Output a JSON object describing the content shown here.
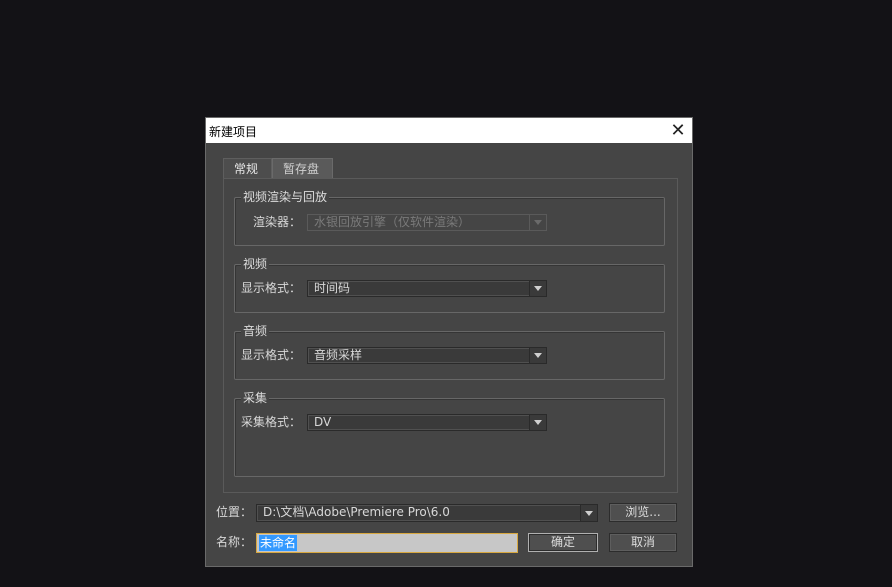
{
  "dialog": {
    "title": "新建项目",
    "close_glyph": "✕"
  },
  "tabs": [
    {
      "label": "常规",
      "active": true
    },
    {
      "label": "暂存盘",
      "active": false
    }
  ],
  "groups": {
    "render": {
      "title": "视频渲染与回放",
      "label": "渲染器：",
      "value": "水银回放引擎（仅软件渲染）",
      "disabled": true
    },
    "video": {
      "title": "视频",
      "label": "显示格式：",
      "value": "时间码"
    },
    "audio": {
      "title": "音频",
      "label": "显示格式：",
      "value": "音频采样"
    },
    "capture": {
      "title": "采集",
      "label": "采集格式：",
      "value": "DV"
    }
  },
  "location": {
    "label": "位置：",
    "value": "D:\\文档\\Adobe\\Premiere Pro\\6.0",
    "browse_label": "浏览..."
  },
  "name": {
    "label": "名称：",
    "value": "未命名"
  },
  "buttons": {
    "ok": "确定",
    "cancel": "取消"
  },
  "icons": {
    "close": "close-icon",
    "dropdown": "chevron-down-icon"
  },
  "colors": {
    "background": "#131216",
    "dialog": "#454545",
    "selection": "#3399ff",
    "focus_border": "#d8a840"
  }
}
